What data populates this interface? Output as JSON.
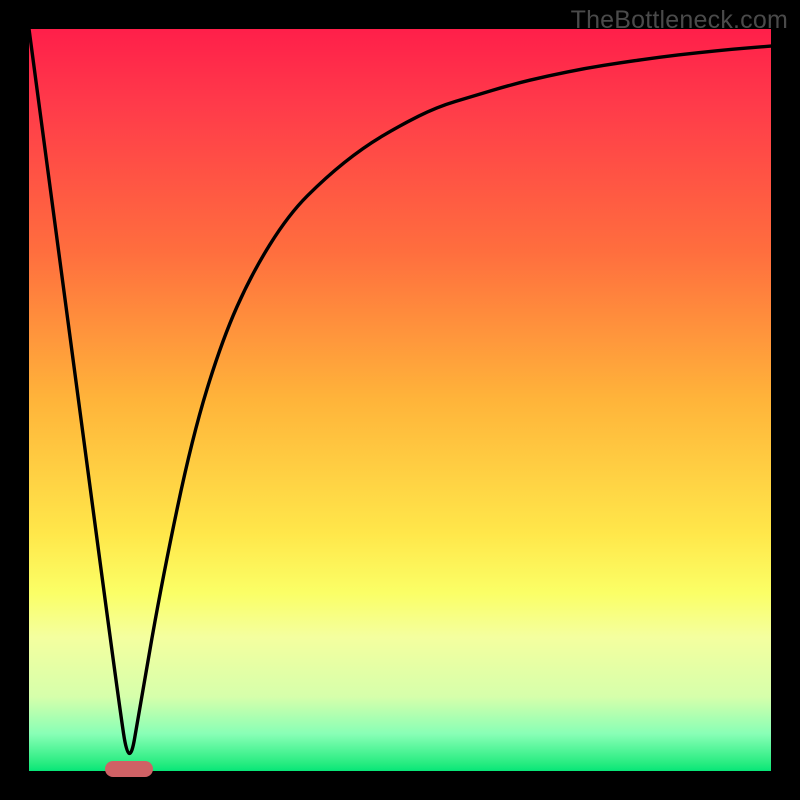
{
  "watermark_text": "TheBottleneck.com",
  "chart_data": {
    "type": "line",
    "title": "",
    "xlabel": "",
    "ylabel": "",
    "xlim": [
      0,
      100
    ],
    "ylim": [
      0,
      100
    ],
    "grid": false,
    "series": [
      {
        "name": "curve",
        "x": [
          0,
          6,
          12,
          13.5,
          15,
          18,
          22,
          26,
          30,
          35,
          40,
          45,
          50,
          55,
          60,
          65,
          70,
          75,
          80,
          85,
          90,
          95,
          100
        ],
        "values": [
          100,
          55,
          10,
          0,
          9,
          26,
          45,
          58,
          67,
          75,
          80,
          84,
          87,
          89.5,
          91,
          92.5,
          93.7,
          94.7,
          95.5,
          96.2,
          96.8,
          97.3,
          97.7
        ]
      }
    ],
    "marker": {
      "x_center": 13.5,
      "y": 0,
      "width_pct": 6.5
    },
    "background_gradient": {
      "stops": [
        {
          "pos": 0.0,
          "color": "#ff1f4a"
        },
        {
          "pos": 0.3,
          "color": "#ff6e3e"
        },
        {
          "pos": 0.5,
          "color": "#ffb43a"
        },
        {
          "pos": 0.76,
          "color": "#fbff66"
        },
        {
          "pos": 0.95,
          "color": "#88ffb6"
        },
        {
          "pos": 1.0,
          "color": "#07e678"
        }
      ]
    }
  }
}
